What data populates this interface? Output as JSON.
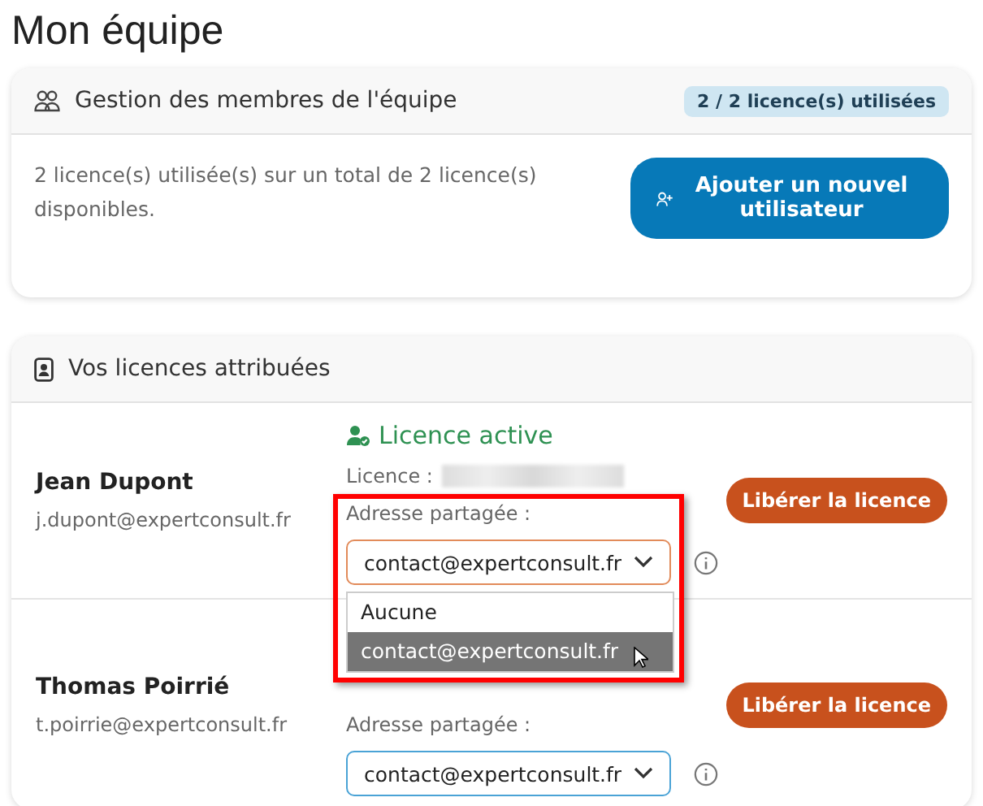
{
  "page_title": "Mon équipe",
  "team_card": {
    "title": "Gestion des membres de l'équipe",
    "badge": "2 / 2 licence(s) utilisées",
    "summary": "2 licence(s) utilisée(s) sur un total de 2 licence(s) disponibles.",
    "add_button": "Ajouter un nouvel utilisateur"
  },
  "licences_card": {
    "title": "Vos licences attribuées",
    "users": [
      {
        "name": "Jean Dupont",
        "email": "j.dupont@expertconsult.fr",
        "status": "Licence active",
        "licence_label": "Licence :",
        "address_label": "Adresse partagée :",
        "address_select": {
          "value": "contact@expertconsult.fr",
          "open": true,
          "options": [
            {
              "label": "Aucune",
              "selected": false
            },
            {
              "label": "contact@expertconsult.fr",
              "selected": true
            }
          ]
        },
        "release_button": "Libérer la licence"
      },
      {
        "name": "Thomas Poirrié",
        "email": "t.poirrie@expertconsult.fr",
        "address_label": "Adresse partagée :",
        "address_select": {
          "value": "contact@expertconsult.fr",
          "open": false
        },
        "release_button": "Libérer la licence"
      }
    ]
  }
}
